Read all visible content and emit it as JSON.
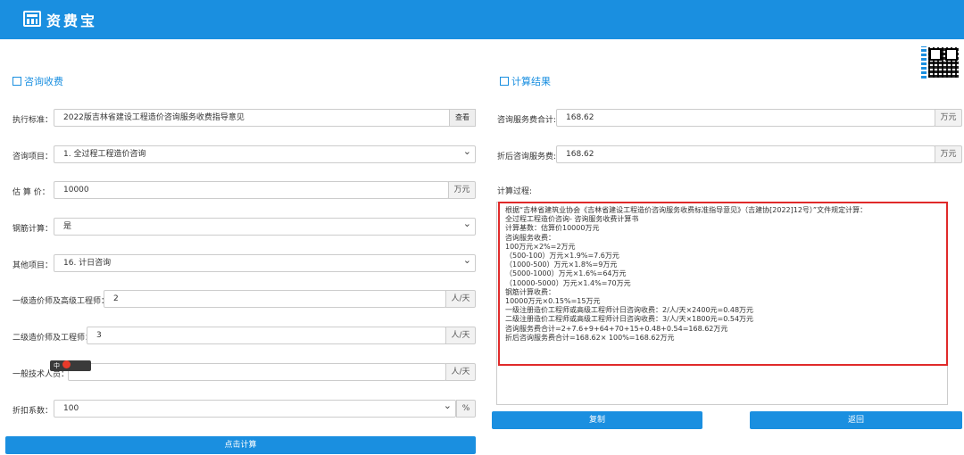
{
  "app": {
    "title": "资费宝"
  },
  "left": {
    "section_title": "咨询收费",
    "standard": {
      "label": "执行标准：",
      "value": "2022版吉林省建设工程造价咨询服务收费指导意见",
      "button": "查看"
    },
    "project": {
      "label": "咨询项目：",
      "value": "1. 全过程工程造价咨询"
    },
    "estimate": {
      "label": "估 算 价：",
      "value": "10000",
      "unit": "万元"
    },
    "rebar": {
      "label": "钢筋计算：",
      "value": "是"
    },
    "other": {
      "label": "其他项目：",
      "value": "16. 计日咨询"
    },
    "senior": {
      "label": "一级造价师及高级工程师：",
      "value": "2",
      "unit": "人/天"
    },
    "junior": {
      "label": "二级造价师及工程师：",
      "value": "3",
      "unit": "人/天"
    },
    "tech": {
      "label": "一般技术人员：",
      "value": "",
      "unit": "人/天"
    },
    "discount": {
      "label": "折扣系数：",
      "value": "100",
      "unit": "%"
    },
    "calc_button": "点击计算"
  },
  "right": {
    "section_title": "计算结果",
    "total": {
      "label": "咨询服务费合计:",
      "value": "168.62",
      "unit": "万元"
    },
    "discounted": {
      "label": "折后咨询服务费:",
      "value": "168.62",
      "unit": "万元"
    },
    "process_label": "计算过程:",
    "process_lines": [
      "根据“吉林省建筑业协会《吉林省建设工程造价咨询服务收费标准指导意见》（吉建协[2022]12号）”文件规定计算：",
      "全过程工程造价咨询- 咨询服务收费计算书",
      "计算基数：估算价10000万元",
      "咨询服务收费：",
      "100万元×2%=2万元",
      "（500-100）万元×1.9%=7.6万元",
      "（1000-500）万元×1.8%=9万元",
      "（5000-1000）万元×1.6%=64万元",
      "（10000-5000）万元×1.4%=70万元",
      "钢筋计算收费：",
      "10000万元×0.15%=15万元",
      "一级注册造价工程师或高级工程师计日咨询收费：2/人/天×2400元=0.48万元",
      "二级注册造价工程师或高级工程师计日咨询收费：3/人/天×1800元=0.54万元",
      "咨询服务费合计=2+7.6+9+64+70+15+0.48+0.54=168.62万元",
      "折后咨询服务费合计=168.62× 100%=168.62万元"
    ],
    "copy_button": "复制",
    "back_button": "返回"
  },
  "ime": {
    "label": "中"
  }
}
